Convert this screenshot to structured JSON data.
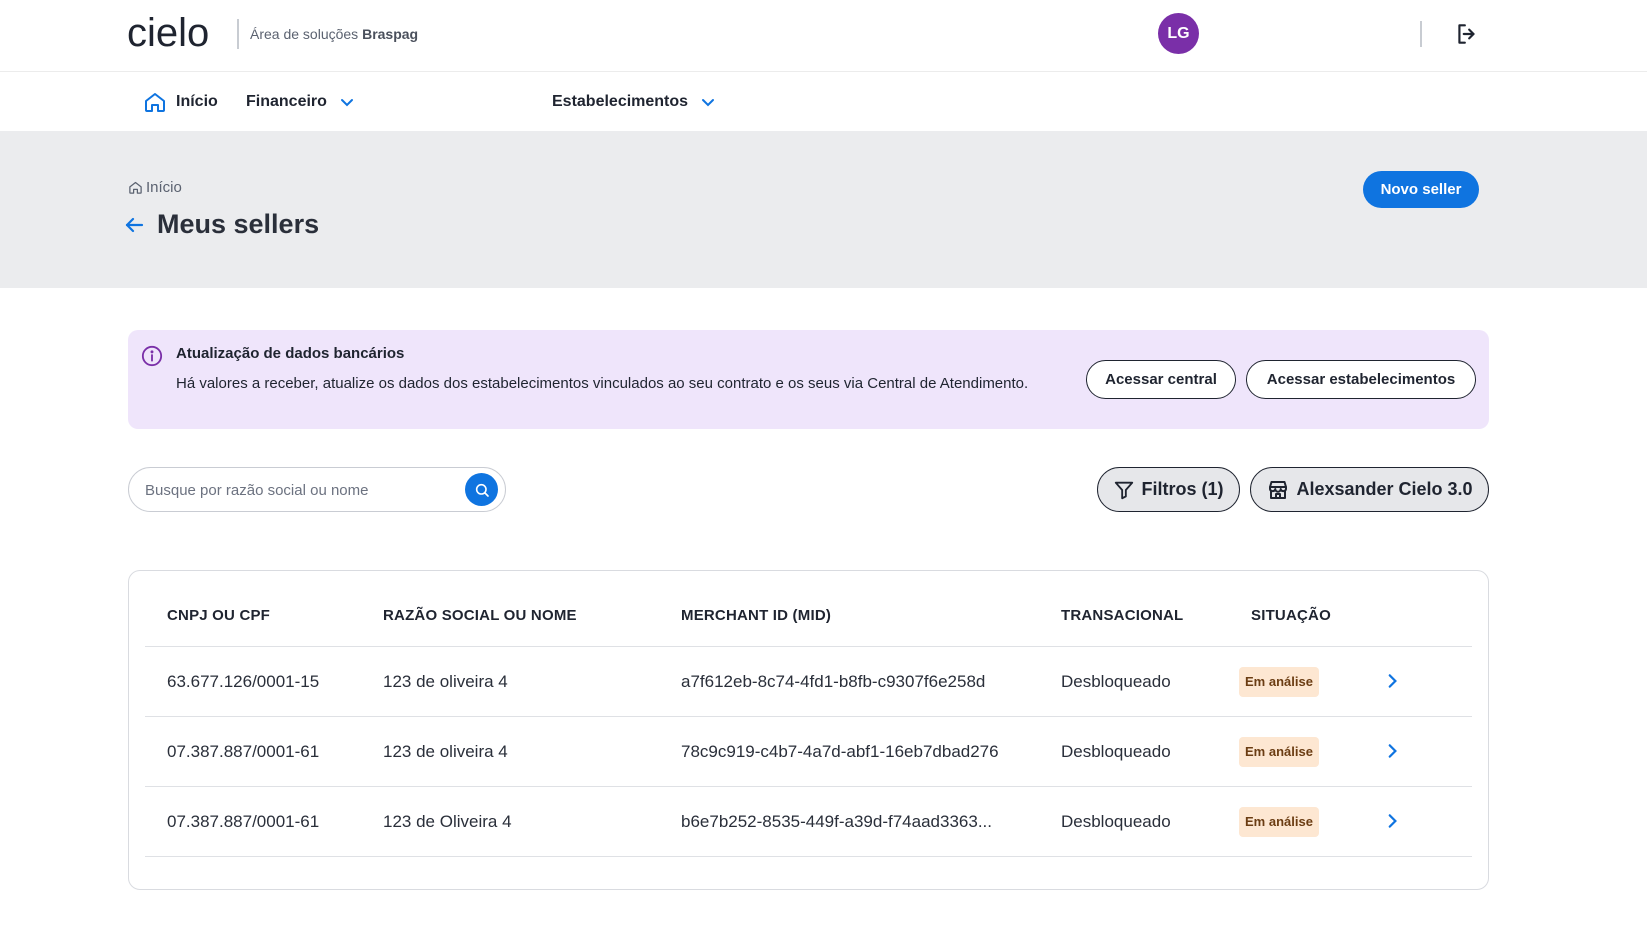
{
  "header": {
    "logo_text": "cielo",
    "area_prefix": "Área de soluções",
    "area_brand": "Braspag",
    "avatar_initials": "LG"
  },
  "nav": {
    "items": [
      {
        "label": "Início",
        "icon": "home-icon"
      },
      {
        "label": "Financeiro",
        "icon": "chevron-down-icon"
      },
      {
        "label": "Estabelecimentos",
        "icon": "chevron-down-icon"
      }
    ]
  },
  "hero": {
    "breadcrumb": "Início",
    "title": "Meus sellers",
    "new_button": "Novo seller"
  },
  "alert": {
    "title": "Atualização de dados bancários",
    "text": "Há valores a receber, atualize os dados dos estabelecimentos vinculados ao seu contrato e os seus via Central de Atendimento.",
    "btn_central": "Acessar central",
    "btn_estab": "Acessar estabelecimentos"
  },
  "search": {
    "placeholder": "Busque por razão social ou nome"
  },
  "filters": {
    "filter_label": "Filtros (1)",
    "store_label": "Alexsander Cielo 3.0"
  },
  "table": {
    "headers": [
      "CNPJ OU CPF",
      "RAZÃO SOCIAL OU NOME",
      "MERCHANT ID (MID)",
      "TRANSACIONAL",
      "SITUAÇÃO"
    ],
    "rows": [
      {
        "doc": "63.677.126/0001-15",
        "name": "123 de oliveira 4",
        "mid": "a7f612eb-8c74-4fd1-b8fb-c9307f6e258d",
        "trans": "Desbloqueado",
        "status": "Em análise"
      },
      {
        "doc": "07.387.887/0001-61",
        "name": "123 de oliveira 4",
        "mid": "78c9c919-c4b7-4a7d-abf1-16eb7dbad276",
        "trans": "Desbloqueado",
        "status": "Em análise"
      },
      {
        "doc": "07.387.887/0001-61",
        "name": "123 de Oliveira 4",
        "mid": "b6e7b252-8535-449f-a39d-f74aad3363...",
        "trans": "Desbloqueado",
        "status": "Em análise"
      }
    ]
  },
  "colors": {
    "primary": "#0f74e0",
    "avatar": "#7a2fa8",
    "alert_bg": "#efe5fb",
    "badge_bg": "#fde7d2"
  }
}
